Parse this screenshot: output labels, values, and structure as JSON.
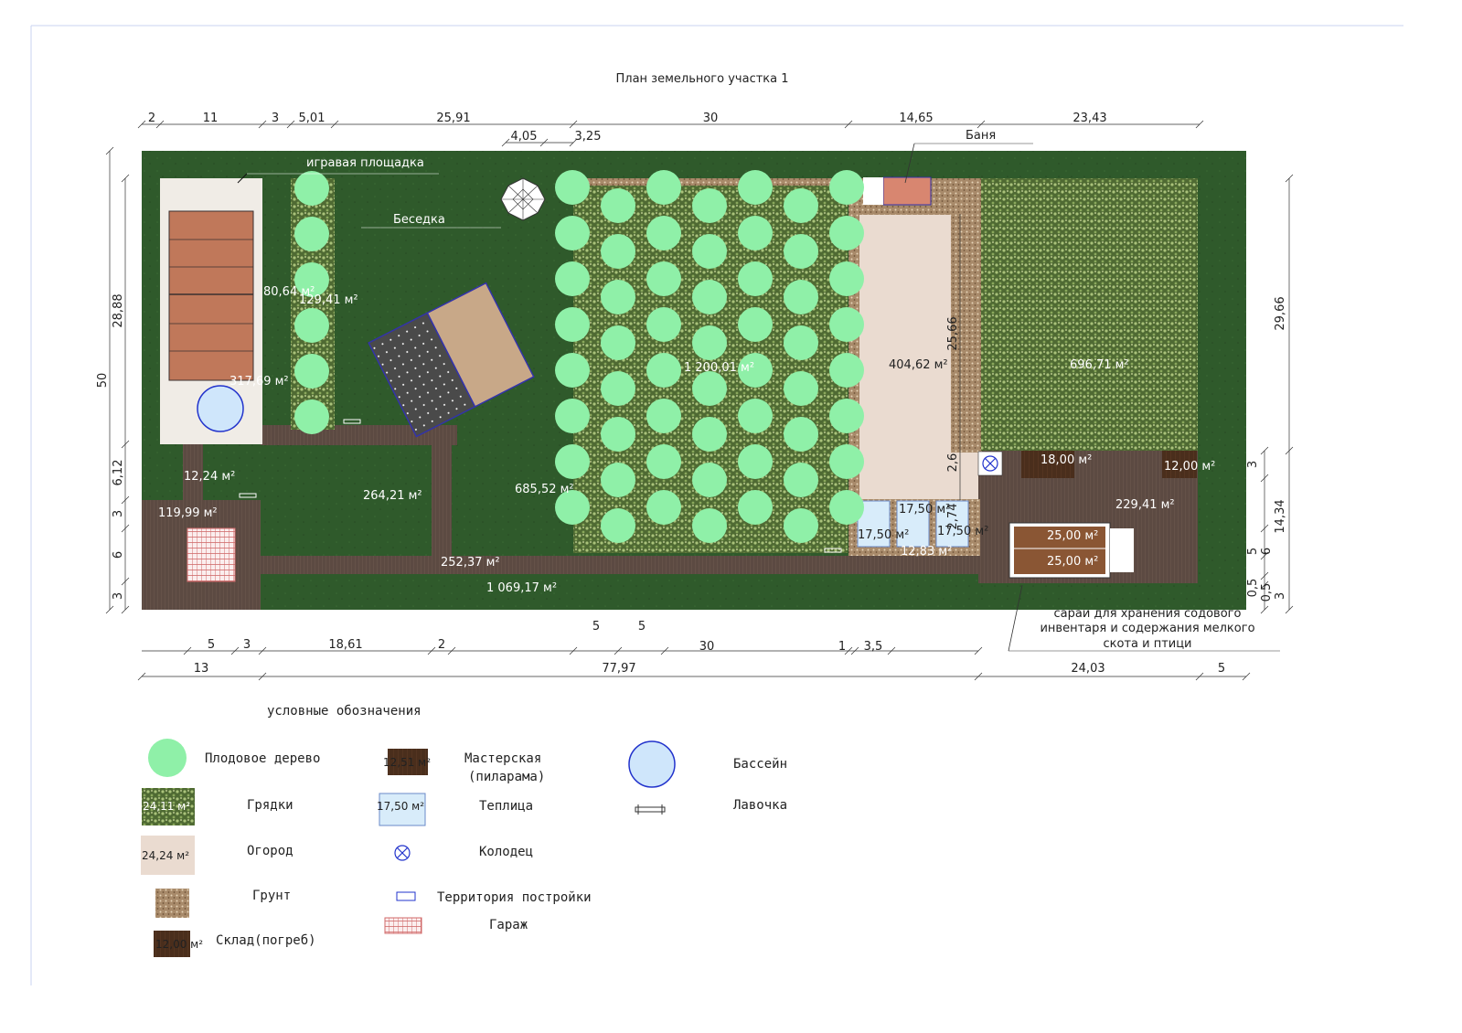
{
  "title": "План земельного участка 1",
  "colors": {
    "lawn": "#2f5a2b",
    "path": "#5c4a42",
    "beds": "#4f6a33",
    "garden": "#eadbd0",
    "soil": "#b59878",
    "tree": "#8ff0a8",
    "tennis": "#c0785a",
    "pool": "#cfe6fb",
    "storage": "#4a2e1c",
    "greenhouse": "#d8ecfa"
  },
  "labels": {
    "playground": "игравая площадка",
    "gazebo": "Беседка",
    "bath": "Баня",
    "shed_note": [
      "сараи для хранения содового",
      "инвентаря и содержания мелкого",
      "скота и птици"
    ]
  },
  "areas": {
    "a1": "80,64 м²",
    "a2": "129,41 м²",
    "a3": "317,69 м²",
    "a4": "1 200,01 м²",
    "a5": "404,62 м²",
    "a6": "696,71 м²",
    "a7": "12,24 м²",
    "a8": "119,99 м²",
    "a9": "264,21 м²",
    "a10": "685,52 м²",
    "a11": "252,37 м²",
    "a12": "1 069,17 м²",
    "a13": "18,00 м²",
    "a14": "12,00 м²",
    "a15": "229,41 м²",
    "a16": "25,00 м²",
    "a17": "25,00 м²",
    "a18": "17,50 м²",
    "a19": "17,50 м²",
    "a20": "17,50 м²",
    "a21": "12,83 м²"
  },
  "dims": {
    "top1": [
      "2",
      "11",
      "3",
      "5,01",
      "25,91",
      "30",
      "14,65",
      "23,43"
    ],
    "top2": [
      "4,05",
      "3,25"
    ],
    "bottom1": [
      "5",
      "3",
      "18,61",
      "2",
      "5",
      "5",
      "30",
      "1",
      "3,5"
    ],
    "bottom2": [
      "13",
      "77,97",
      "24,03",
      "5"
    ],
    "left": [
      "50",
      "28,88",
      "6,12",
      "3",
      "6",
      "3"
    ],
    "right": [
      "29,66",
      "3",
      "14,34",
      "5",
      "6",
      "0,5",
      "0,5",
      "3"
    ],
    "inner": [
      "25,66",
      "2,6",
      "2,74"
    ]
  },
  "legend": {
    "title": "условные обозначения",
    "items": {
      "tree": "Плодовое дерево",
      "beds": "Грядки",
      "garden": "Огород",
      "soil": "Грунт",
      "storage": "Склад(погреб)",
      "workshop": [
        "Мастерская",
        "(пиларама)"
      ],
      "greenhouse": "Теплица",
      "well": "Колодец",
      "territory": "Территория постройки",
      "garage": "Гараж",
      "pool": "Бассейн",
      "bench": "Лавочка"
    },
    "swatches": {
      "beds": "24,11 м²",
      "garden": "24,24 м²",
      "storage": "12,00 м²",
      "workshop": "12,51 м²",
      "greenhouse": "17,50 м²"
    }
  }
}
